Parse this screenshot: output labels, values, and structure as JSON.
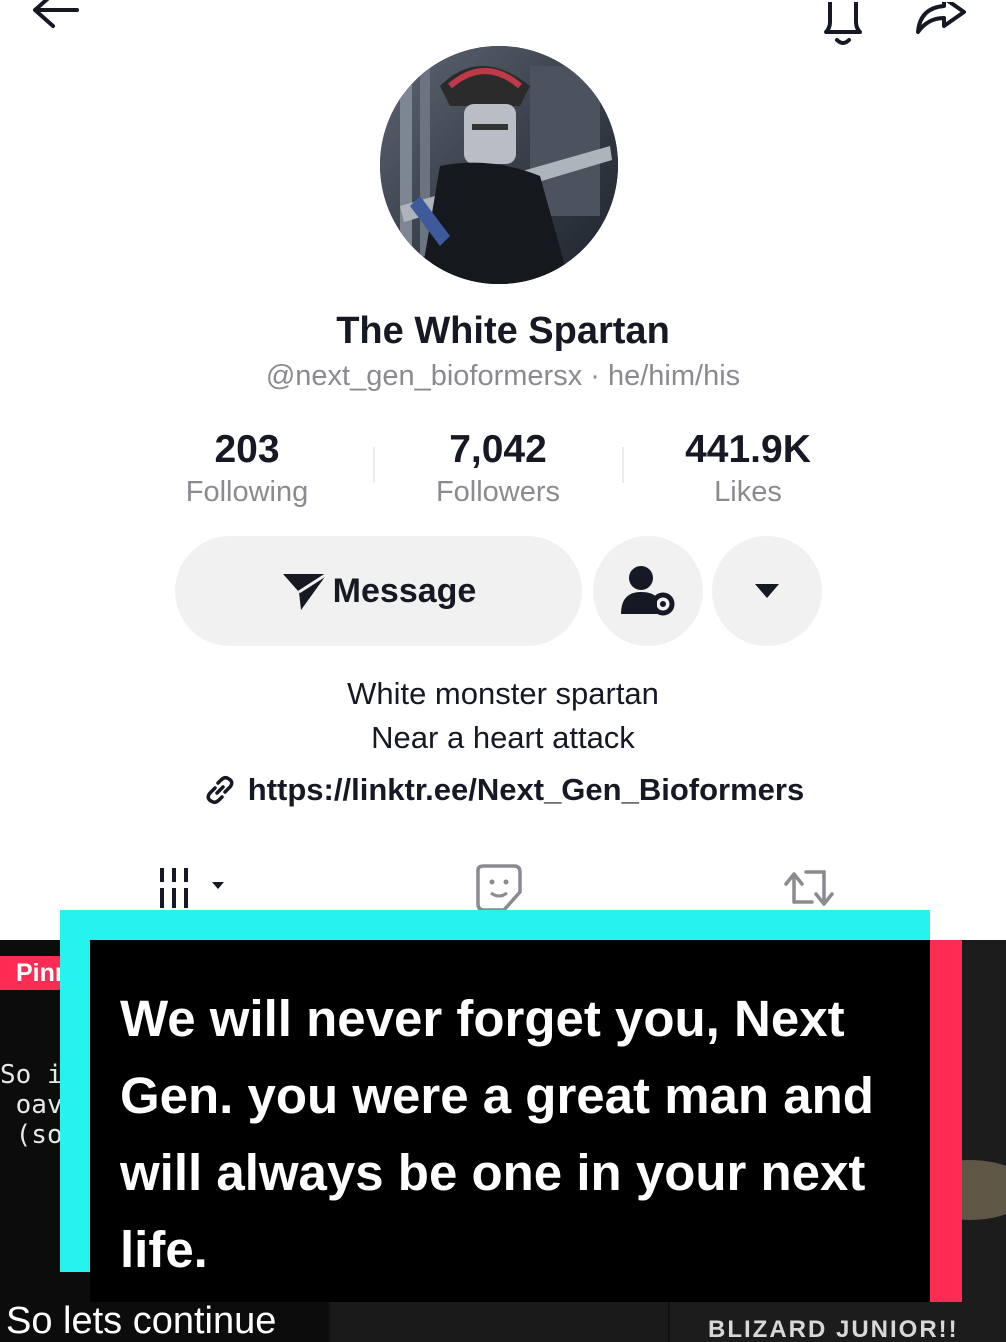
{
  "profile": {
    "display_name": "The White Spartan",
    "handle_line": "@next_gen_bioformersx · he/him/his"
  },
  "stats": {
    "following": {
      "value": "203",
      "label": "Following"
    },
    "followers": {
      "value": "7,042",
      "label": "Followers"
    },
    "likes": {
      "value": "441.9K",
      "label": "Likes"
    }
  },
  "actions": {
    "message_label": "Message"
  },
  "bio": {
    "line1": "White monster spartan",
    "line2": "Near a heart attack",
    "link": "https://linktr.ee/Next_Gen_Bioformers"
  },
  "grid": {
    "pinned_label": "Pinned",
    "tile1_text": "So if\n oav\n (so",
    "tile1_caption": "So lets continue",
    "tile3_caption": "BLIZARD JUNIOR!!"
  },
  "overlay": {
    "caption": "We will never forget you, Next Gen. you were a great man and will always be one in your next life."
  },
  "colors": {
    "accent_red": "#fe2c55",
    "accent_cyan": "#25f4ee",
    "text_secondary": "#8a8b91",
    "button_bg": "#f1f1f2"
  },
  "icons": {
    "back": "arrow-left-icon",
    "bell": "bell-icon",
    "share": "share-icon",
    "message": "send-icon",
    "friend": "user-settings-icon",
    "more": "caret-down-icon",
    "link": "link-icon",
    "videos_tab": "grid-icon",
    "stickers_tab": "sticker-icon",
    "repost_tab": "repost-icon"
  }
}
